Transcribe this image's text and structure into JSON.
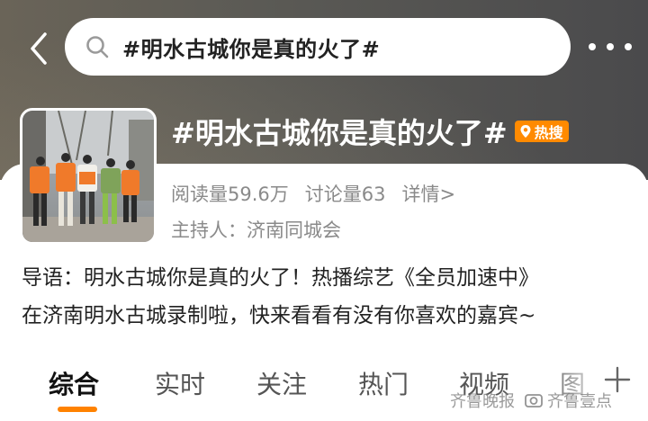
{
  "search": {
    "query": "#明水古城你是真的火了#"
  },
  "topic": {
    "title": "#明水古城你是真的火了#",
    "badge": "热搜",
    "reads": "阅读量59.6万",
    "discussions": "讨论量63",
    "details": "详情>",
    "host": "主持人：济南同城会"
  },
  "intro": {
    "line1": "导语：明水古城你是真的火了！热播综艺《全员加速中》",
    "line2": "在济南明水古城录制啦，快来看看有没有你喜欢的嘉宾~"
  },
  "tabs": [
    {
      "label": "综合"
    },
    {
      "label": "实时"
    },
    {
      "label": "关注"
    },
    {
      "label": "热门"
    },
    {
      "label": "视频"
    },
    {
      "label": "图"
    }
  ],
  "watermark": {
    "text1": "齐鲁晚报",
    "text2": "齐鲁壹点"
  },
  "colors": {
    "accent": "#ff8200",
    "badge": "#ff8a00",
    "header_bg": "#5b5a55"
  },
  "icons": [
    "back-arrow-icon",
    "search-icon",
    "more-dots-icon",
    "location-pin-icon",
    "plus-icon",
    "camera-icon"
  ]
}
